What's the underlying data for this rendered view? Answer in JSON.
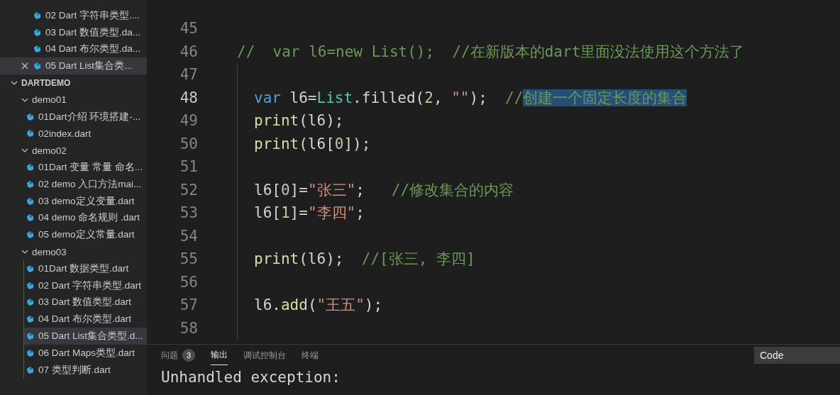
{
  "sidebar": {
    "open_editors": [
      {
        "label": "02 Dart 字符串类型....",
        "selected": false
      },
      {
        "label": "03 Dart 数值类型.da...",
        "selected": false
      },
      {
        "label": "04 Dart 布尔类型.da...",
        "selected": false
      },
      {
        "label": "05 Dart List集合类...",
        "selected": true
      }
    ],
    "tree": {
      "label": "DARTDEMO",
      "expanded": true,
      "children": [
        {
          "label": "demo01",
          "expanded": true,
          "children": [
            {
              "label": "01Dart介绍 环境搭建-...",
              "selected": false
            },
            {
              "label": "02index.dart",
              "selected": false
            }
          ]
        },
        {
          "label": "demo02",
          "expanded": true,
          "children": [
            {
              "label": "01Dart 变量 常量 命名...",
              "selected": false
            },
            {
              "label": "02 demo 入口方法mai...",
              "selected": false
            },
            {
              "label": "03 demo定义变量.dart",
              "selected": false
            },
            {
              "label": "04 demo 命名规则 .dart",
              "selected": false
            },
            {
              "label": "05 demo定义常量.dart",
              "selected": false
            }
          ]
        },
        {
          "label": "demo03",
          "expanded": true,
          "children": [
            {
              "label": "01Dart 数据类型.dart",
              "selected": false
            },
            {
              "label": "02 Dart 字符串类型.dart",
              "selected": false
            },
            {
              "label": "03 Dart 数值类型.dart",
              "selected": false
            },
            {
              "label": "04 Dart 布尔类型.dart",
              "selected": false
            },
            {
              "label": "05 Dart List集合类型.d...",
              "selected": true
            },
            {
              "label": "06 Dart Maps类型.dart",
              "selected": false
            },
            {
              "label": "07 类型判断.dart",
              "selected": false
            }
          ]
        }
      ]
    }
  },
  "editor": {
    "lines": [
      {
        "number": "45",
        "current": false,
        "indented": false
      },
      {
        "number": "46",
        "current": false,
        "indented": false,
        "tokens": [
          {
            "text": "//  var l6=new List();  //在新版本的dart里面没法使用这个方法了",
            "kind": "comment"
          }
        ]
      },
      {
        "number": "47",
        "current": false,
        "indented": true
      },
      {
        "number": "48",
        "current": true,
        "indented": true,
        "tokens": [
          {
            "text": "var",
            "kind": "keyword"
          },
          {
            "text": " l6=",
            "kind": "plain"
          },
          {
            "text": "List",
            "kind": "type"
          },
          {
            "text": ".filled(",
            "kind": "plain"
          },
          {
            "text": "2",
            "kind": "number"
          },
          {
            "text": ", ",
            "kind": "plain"
          },
          {
            "text": "\"\"",
            "kind": "string"
          },
          {
            "text": ");  ",
            "kind": "plain"
          },
          {
            "text": "//",
            "kind": "comment"
          },
          {
            "text": "创建一个固定长度的集合",
            "kind": "selection"
          }
        ]
      },
      {
        "number": "49",
        "current": false,
        "indented": true,
        "tokens": [
          {
            "text": "print",
            "kind": "function"
          },
          {
            "text": "(l6);",
            "kind": "plain"
          }
        ]
      },
      {
        "number": "50",
        "current": false,
        "indented": true,
        "tokens": [
          {
            "text": "print",
            "kind": "function"
          },
          {
            "text": "(l6[",
            "kind": "plain"
          },
          {
            "text": "0",
            "kind": "number"
          },
          {
            "text": "]);",
            "kind": "plain"
          }
        ]
      },
      {
        "number": "51",
        "current": false,
        "indented": true
      },
      {
        "number": "52",
        "current": false,
        "indented": true,
        "tokens": [
          {
            "text": "l6[",
            "kind": "plain"
          },
          {
            "text": "0",
            "kind": "number"
          },
          {
            "text": "]=",
            "kind": "plain"
          },
          {
            "text": "\"张三\"",
            "kind": "string"
          },
          {
            "text": ";   ",
            "kind": "plain"
          },
          {
            "text": "//修改集合的内容",
            "kind": "comment"
          }
        ]
      },
      {
        "number": "53",
        "current": false,
        "indented": true,
        "tokens": [
          {
            "text": "l6[",
            "kind": "plain"
          },
          {
            "text": "1",
            "kind": "number"
          },
          {
            "text": "]=",
            "kind": "plain"
          },
          {
            "text": "\"李四\"",
            "kind": "string"
          },
          {
            "text": ";",
            "kind": "plain"
          }
        ]
      },
      {
        "number": "54",
        "current": false,
        "indented": true
      },
      {
        "number": "55",
        "current": false,
        "indented": true,
        "tokens": [
          {
            "text": "print",
            "kind": "function"
          },
          {
            "text": "(l6);  ",
            "kind": "plain"
          },
          {
            "text": "//[张三, 李四]",
            "kind": "comment"
          }
        ]
      },
      {
        "number": "56",
        "current": false,
        "indented": true
      },
      {
        "number": "57",
        "current": false,
        "indented": true,
        "tokens": [
          {
            "text": "l6.",
            "kind": "plain"
          },
          {
            "text": "add",
            "kind": "function"
          },
          {
            "text": "(",
            "kind": "plain"
          },
          {
            "text": "\"王五\"",
            "kind": "string"
          },
          {
            "text": ");",
            "kind": "plain"
          }
        ]
      },
      {
        "number": "58",
        "current": false,
        "indented": true
      }
    ]
  },
  "panel": {
    "tabs": [
      {
        "label": "问题",
        "badge": "3",
        "selected": false
      },
      {
        "label": "输出",
        "selected": true
      },
      {
        "label": "调试控制台",
        "selected": false
      },
      {
        "label": "终端",
        "selected": false
      }
    ],
    "dropdown": {
      "value": "Code"
    },
    "output": [
      "Unhandled exception:"
    ]
  }
}
